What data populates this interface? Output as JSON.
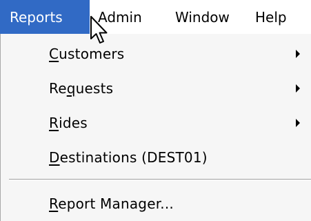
{
  "menubar": {
    "items": [
      {
        "label": "Reports",
        "active": true
      },
      {
        "label": "Admin",
        "active": false
      },
      {
        "label": "Window",
        "active": false
      },
      {
        "label": "Help",
        "active": false
      }
    ]
  },
  "dropdown": {
    "items": [
      {
        "label_pre": "",
        "label_mnemonic": "C",
        "label_post": "ustomers",
        "has_submenu": true
      },
      {
        "label_pre": "Re",
        "label_mnemonic": "q",
        "label_post": "uests",
        "has_submenu": true
      },
      {
        "label_pre": "",
        "label_mnemonic": "R",
        "label_post": "ides",
        "has_submenu": true
      },
      {
        "label_pre": "",
        "label_mnemonic": "D",
        "label_post": "estinations (DEST01)",
        "has_submenu": false
      },
      {
        "label_pre": "",
        "label_mnemonic": "R",
        "label_post": "eport Manager...",
        "has_submenu": false
      }
    ]
  },
  "colors": {
    "highlight": "#316ac5",
    "menu_background": "#f6f6f6",
    "text": "#000000"
  },
  "icons": {
    "cursor": "mouse-pointer-icon",
    "submenu": "triangle-right-icon"
  }
}
